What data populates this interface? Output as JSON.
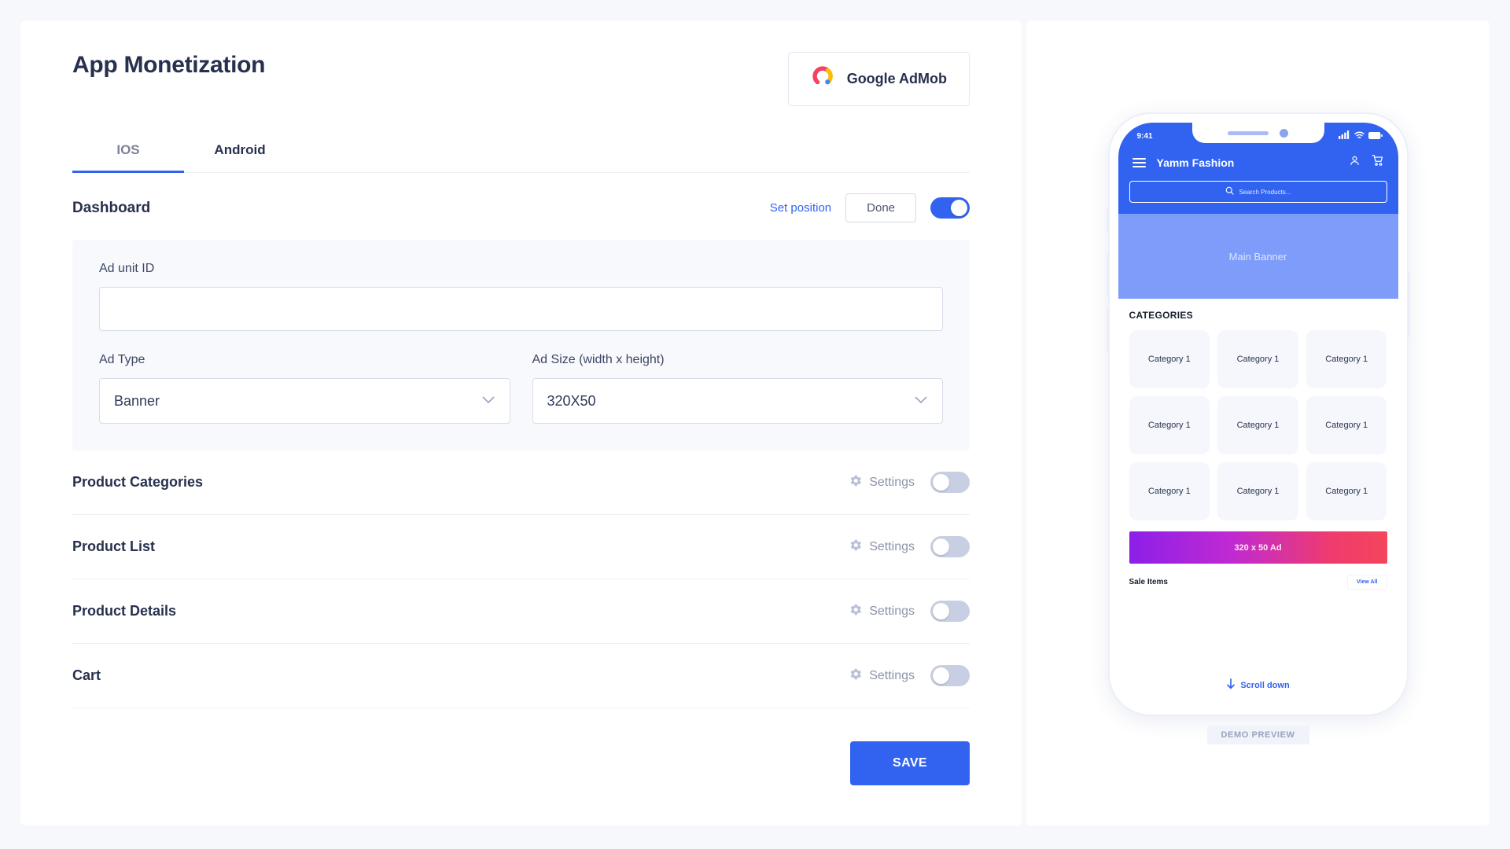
{
  "header": {
    "title": "App Monetization",
    "admob_button": "Google AdMob"
  },
  "tabs": [
    {
      "label": "IOS",
      "active": true
    },
    {
      "label": "Android",
      "active": false
    }
  ],
  "dashboard": {
    "title": "Dashboard",
    "set_position_label": "Set position",
    "done_label": "Done",
    "toggle_state": "on"
  },
  "ad_form": {
    "ad_unit_id_label": "Ad unit ID",
    "ad_unit_id_value": "",
    "ad_type_label": "Ad Type",
    "ad_type_value": "Banner",
    "ad_size_label": "Ad Size (width x height)",
    "ad_size_value": "320X50"
  },
  "features": [
    {
      "title": "Product Categories",
      "settings_label": "Settings",
      "toggle_state": "off"
    },
    {
      "title": "Product List",
      "settings_label": "Settings",
      "toggle_state": "off"
    },
    {
      "title": "Product Details",
      "settings_label": "Settings",
      "toggle_state": "off"
    },
    {
      "title": "Cart",
      "settings_label": "Settings",
      "toggle_state": "off"
    }
  ],
  "footer": {
    "save_label": "SAVE"
  },
  "preview": {
    "badge": "DEMO PREVIEW",
    "status_time": "9:41",
    "app_name": "Yamm Fashion",
    "search_placeholder": "Search Products...",
    "main_banner_label": "Main Banner",
    "categories_heading": "CATEGORIES",
    "categories": [
      "Category 1",
      "Category 1",
      "Category 1",
      "Category 1",
      "Category 1",
      "Category 1",
      "Category 1",
      "Category 1",
      "Category 1"
    ],
    "ad_banner_label": "320 x 50 Ad",
    "sale_title": "Sale Items",
    "view_all_label": "View All",
    "scroll_down_label": "Scroll down"
  },
  "colors": {
    "accent": "#3163f0",
    "text_dark": "#27304e",
    "toggle_off": "#c9cfe2",
    "banner_blue": "#7e9dfb",
    "page_bg": "#f7f8fc"
  }
}
